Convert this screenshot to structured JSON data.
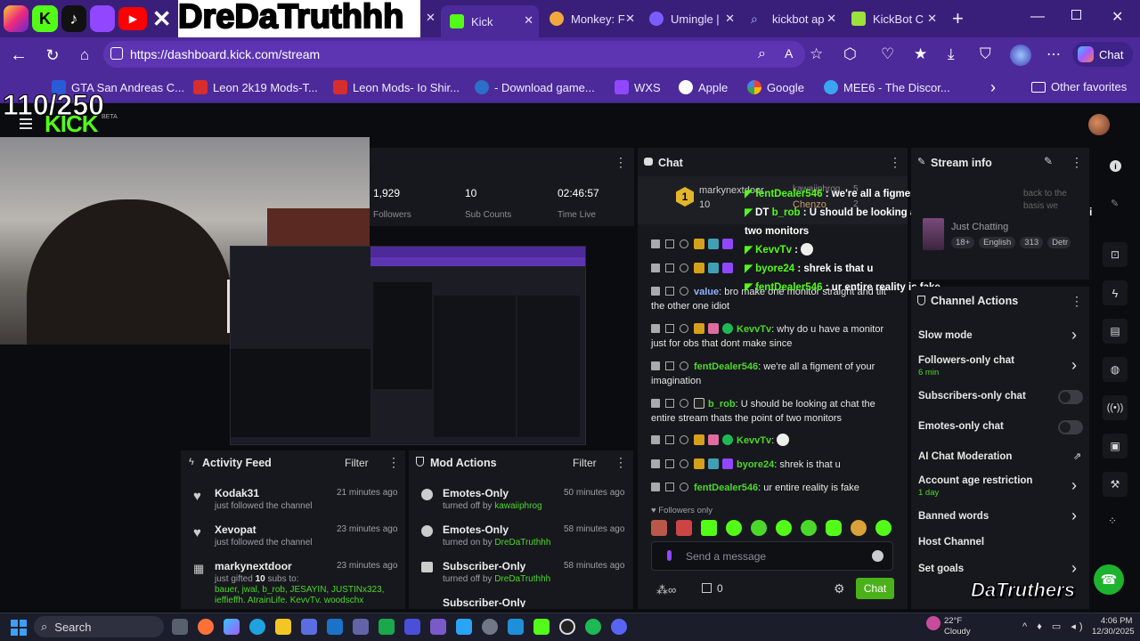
{
  "overlay": {
    "social_handle": "DreDaTruthhh",
    "counter": "110/250",
    "watermark": "DaTruthers"
  },
  "tabs": [
    {
      "label": "Kick",
      "color": "#53fc18"
    },
    {
      "label": "Monkey: F",
      "color": "#f2a93b"
    },
    {
      "label": "Umingle |",
      "color": "#7b5cff"
    },
    {
      "label": "kickbot ap",
      "color": "#4a8cff"
    },
    {
      "label": "KickBot C",
      "color": "#9be23a"
    }
  ],
  "address_bar": {
    "url": "https://dashboard.kick.com/stream",
    "copilot_label": "Chat"
  },
  "bookmarks": [
    {
      "label": "GTA San Andreas C...",
      "color": "#2a5bd7"
    },
    {
      "label": "Leon 2k19 Mods-T...",
      "color": "#d62d2d"
    },
    {
      "label": "Leon Mods- Io Shir...",
      "color": "#d62d2d"
    },
    {
      "label": "- Download game...",
      "color": "#2b6fc6"
    },
    {
      "label": "WXS",
      "color": "#9146ff"
    },
    {
      "label": "Apple",
      "color": "#ffffff"
    },
    {
      "label": "Google",
      "color": "#e8453c"
    },
    {
      "label": "MEE6 - The Discor...",
      "color": "#3aa5f0"
    }
  ],
  "bookmarks_other": "Other favorites",
  "dashboard": {
    "logo": "KICK",
    "beta": "BETA",
    "stats": {
      "followers_value": "1,929",
      "followers_label": "Followers",
      "subs_value": "10",
      "subs_label": "Sub Counts",
      "time_value": "02:46:57",
      "time_label": "Time Live"
    },
    "activity_feed": {
      "title": "Activity Feed",
      "filter": "Filter",
      "items": [
        {
          "user": "Kodak31",
          "time": "21 minutes ago",
          "desc": "just followed the channel"
        },
        {
          "user": "Xevopat",
          "time": "23 minutes ago",
          "desc": "just followed the channel"
        },
        {
          "user": "markynextdoor",
          "time": "23 minutes ago",
          "desc_prefix": "just gifted",
          "count": "10",
          "desc_suffix": "subs to:",
          "recipients": "bauer, jwal, b_rob, JESAYIN, JUSTINx323, jeffieffh, AtrainLife, KevvTv, woodschx"
        }
      ]
    },
    "mod_actions": {
      "title": "Mod Actions",
      "filter": "Filter",
      "items": [
        {
          "action": "Emotes-Only",
          "time": "50 minutes ago",
          "by_prefix": "turned off by",
          "by": "kawaiiphrog"
        },
        {
          "action": "Emotes-Only",
          "time": "58 minutes ago",
          "by_prefix": "turned on by",
          "by": "DreDaTruthhh"
        },
        {
          "action": "Subscriber-Only",
          "time": "58 minutes ago",
          "by_prefix": "turned off by",
          "by": "DreDaTruthhh"
        },
        {
          "action": "Subscriber-Only"
        }
      ]
    },
    "chat": {
      "title": "Chat",
      "leaderboard": {
        "rank": "1",
        "user": "markynextdoor",
        "subs": "10",
        "second_user": "kawaiiphrog",
        "second_count": "5",
        "third_user": "Chenzo",
        "third_count": "2"
      },
      "messages": [
        {
          "user": "value",
          "text": "bro make one monitor straight and tilt the other one idiot",
          "user_color": "#8fb3ff"
        },
        {
          "user": "KevvTv",
          "text": "why do u have a monitor just for obs that dont make since",
          "user_color": "#4bd82a"
        },
        {
          "user": "fentDealer546",
          "text": "we're all a figment of your imagination",
          "user_color": "#4bd82a"
        },
        {
          "user": "b_rob",
          "text": "U should be looking at chat the entire stream thats the point of two monitors",
          "user_color": "#4bd82a"
        },
        {
          "user": "KevvTv",
          "text": "",
          "user_color": "#4bd82a"
        },
        {
          "user": "byore24",
          "text": "shrek is that u",
          "user_color": "#4bd82a"
        },
        {
          "user": "fentDealer546",
          "text": "ur entire reality is fake",
          "user_color": "#4bd82a"
        }
      ],
      "followers_only": "Followers only",
      "placeholder": "Send a message",
      "points": "0",
      "send": "Chat"
    },
    "overlay_chat": [
      {
        "user": "fentDealer546",
        "text": "we're all a figment of your imagination"
      },
      {
        "user": "b_rob",
        "text": "U should be looking at chat the entire stream thats the point of two monitors"
      },
      {
        "user": "KevvTv",
        "text": ""
      },
      {
        "user": "byore24",
        "text": "shrek is that u"
      },
      {
        "user": "fentDealer546",
        "text": "ur entire reality is fake"
      }
    ],
    "stream_info": {
      "title": "Stream info",
      "stream_title": "back to the basis we getting verified versy...",
      "category": "Just Chatting",
      "tags": [
        "18+",
        "English",
        "313",
        "Detr"
      ]
    },
    "channel_actions": {
      "title": "Channel Actions",
      "items": [
        {
          "label": "Slow mode",
          "sub": "",
          "control": "chevron"
        },
        {
          "label": "Followers-only chat",
          "sub": "6 min",
          "control": "chevron"
        },
        {
          "label": "Subscribers-only chat",
          "sub": "",
          "control": "toggle"
        },
        {
          "label": "Emotes-only chat",
          "sub": "",
          "control": "toggle"
        },
        {
          "label": "AI Chat Moderation",
          "sub": "",
          "control": "external"
        },
        {
          "label": "Account age restriction",
          "sub": "1 day",
          "control": "chevron"
        },
        {
          "label": "Banned words",
          "sub": "",
          "control": "chevron"
        },
        {
          "label": "Host Channel",
          "sub": "",
          "control": "none"
        },
        {
          "label": "Set goals",
          "sub": "",
          "control": "chevron"
        }
      ]
    }
  },
  "taskbar": {
    "search": "Search",
    "weather_temp": "22°F",
    "weather_desc": "Cloudy",
    "time": "4:06 PM",
    "date": "12/30/2025"
  },
  "colors": {
    "accent": "#53fc18",
    "browser_purple": "#4d2a9a",
    "panel": "#17181d"
  }
}
